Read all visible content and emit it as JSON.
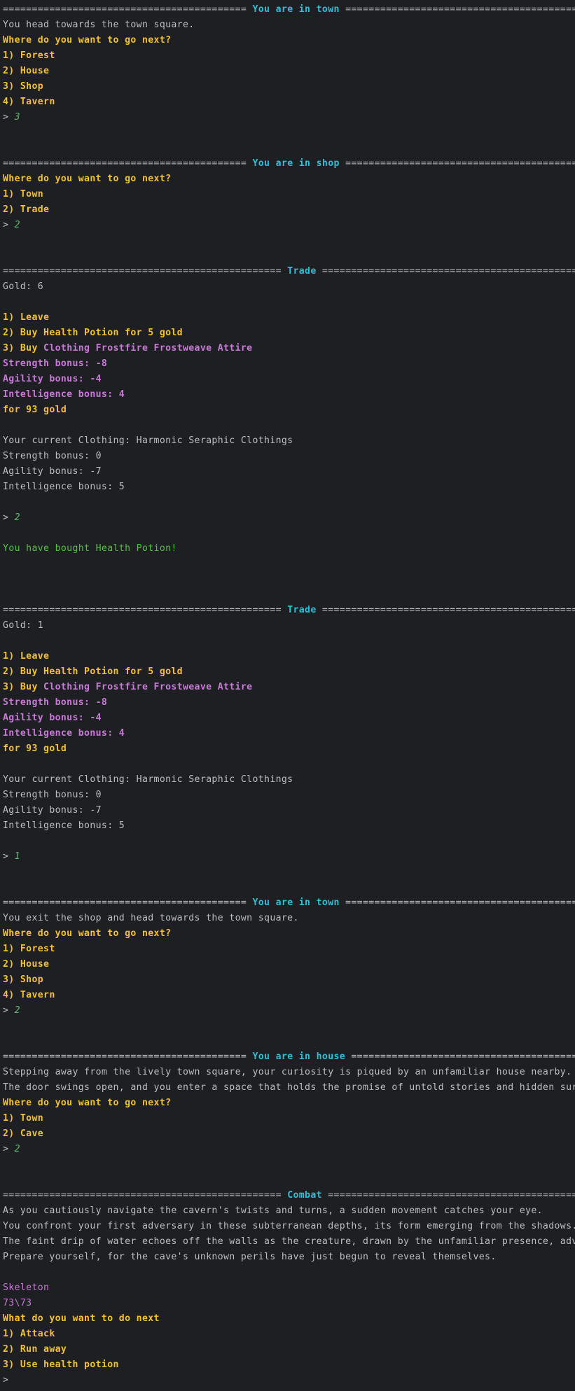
{
  "colors": {
    "background": "#1e1f22",
    "default_text": "#bcbec4",
    "header": "#2fbfd6",
    "menu": "#f2c230",
    "item": "#c77ad6",
    "success": "#4fc43b",
    "input": "#5fb870"
  },
  "lines": [
    [
      {
        "t": "========================================== ",
        "c": "default"
      },
      {
        "t": "You are in town",
        "c": "cyan"
      },
      {
        "t": " ==========================================",
        "c": "default"
      }
    ],
    [
      {
        "t": "You head towards the town square.",
        "c": "default"
      }
    ],
    [
      {
        "t": "Where do you want to go next?",
        "c": "yellow"
      }
    ],
    [
      {
        "t": "1) Forest",
        "c": "yellow"
      }
    ],
    [
      {
        "t": "2) House",
        "c": "yellow"
      }
    ],
    [
      {
        "t": "3) Shop",
        "c": "yellow"
      }
    ],
    [
      {
        "t": "4) Tavern",
        "c": "yellow"
      }
    ],
    [
      {
        "t": "> ",
        "c": "prompt"
      },
      {
        "t": "3",
        "c": "green-italic"
      }
    ],
    [],
    [],
    [
      {
        "t": "========================================== ",
        "c": "default"
      },
      {
        "t": "You are in shop",
        "c": "cyan"
      },
      {
        "t": " ==========================================",
        "c": "default"
      }
    ],
    [
      {
        "t": "Where do you want to go next?",
        "c": "yellow"
      }
    ],
    [
      {
        "t": "1) Town",
        "c": "yellow"
      }
    ],
    [
      {
        "t": "2) Trade",
        "c": "yellow"
      }
    ],
    [
      {
        "t": "> ",
        "c": "prompt"
      },
      {
        "t": "2",
        "c": "green-italic"
      }
    ],
    [],
    [],
    [
      {
        "t": "================================================ ",
        "c": "default"
      },
      {
        "t": "Trade",
        "c": "cyan"
      },
      {
        "t": " ================================================",
        "c": "default"
      }
    ],
    [
      {
        "t": "Gold: 6",
        "c": "default"
      }
    ],
    [],
    [
      {
        "t": "1) Leave",
        "c": "yellow"
      }
    ],
    [
      {
        "t": "2) Buy Health Potion for 5 gold",
        "c": "yellow"
      }
    ],
    [
      {
        "t": "3) Buy ",
        "c": "yellow"
      },
      {
        "t": "Clothing Frostfire Frostweave Attire",
        "c": "purple-bold"
      }
    ],
    [
      {
        "t": "Strength bonus: -8",
        "c": "purple-bold"
      }
    ],
    [
      {
        "t": "Agility bonus: -4",
        "c": "purple-bold"
      }
    ],
    [
      {
        "t": "Intelligence bonus: 4",
        "c": "purple-bold"
      }
    ],
    [
      {
        "t": "for 93 gold",
        "c": "yellow"
      }
    ],
    [],
    [
      {
        "t": "Your current Clothing: Harmonic Seraphic Clothings",
        "c": "default"
      }
    ],
    [
      {
        "t": "Strength bonus: 0",
        "c": "default"
      }
    ],
    [
      {
        "t": "Agility bonus: -7",
        "c": "default"
      }
    ],
    [
      {
        "t": "Intelligence bonus: 5",
        "c": "default"
      }
    ],
    [],
    [
      {
        "t": "> ",
        "c": "prompt"
      },
      {
        "t": "2",
        "c": "green-italic"
      }
    ],
    [],
    [
      {
        "t": "You have bought Health Potion!",
        "c": "green"
      }
    ],
    [],
    [],
    [],
    [
      {
        "t": "================================================ ",
        "c": "default"
      },
      {
        "t": "Trade",
        "c": "cyan"
      },
      {
        "t": " ================================================",
        "c": "default"
      }
    ],
    [
      {
        "t": "Gold: 1",
        "c": "default"
      }
    ],
    [],
    [
      {
        "t": "1) Leave",
        "c": "yellow"
      }
    ],
    [
      {
        "t": "2) Buy Health Potion for 5 gold",
        "c": "yellow"
      }
    ],
    [
      {
        "t": "3) Buy ",
        "c": "yellow"
      },
      {
        "t": "Clothing Frostfire Frostweave Attire",
        "c": "purple-bold"
      }
    ],
    [
      {
        "t": "Strength bonus: -8",
        "c": "purple-bold"
      }
    ],
    [
      {
        "t": "Agility bonus: -4",
        "c": "purple-bold"
      }
    ],
    [
      {
        "t": "Intelligence bonus: 4",
        "c": "purple-bold"
      }
    ],
    [
      {
        "t": "for 93 gold",
        "c": "yellow"
      }
    ],
    [],
    [
      {
        "t": "Your current Clothing: Harmonic Seraphic Clothings",
        "c": "default"
      }
    ],
    [
      {
        "t": "Strength bonus: 0",
        "c": "default"
      }
    ],
    [
      {
        "t": "Agility bonus: -7",
        "c": "default"
      }
    ],
    [
      {
        "t": "Intelligence bonus: 5",
        "c": "default"
      }
    ],
    [],
    [
      {
        "t": "> ",
        "c": "prompt"
      },
      {
        "t": "1",
        "c": "green-italic"
      }
    ],
    [],
    [],
    [
      {
        "t": "========================================== ",
        "c": "default"
      },
      {
        "t": "You are in town",
        "c": "cyan"
      },
      {
        "t": " ==========================================",
        "c": "default"
      }
    ],
    [
      {
        "t": "You exit the shop and head towards the town square.",
        "c": "default"
      }
    ],
    [
      {
        "t": "Where do you want to go next?",
        "c": "yellow"
      }
    ],
    [
      {
        "t": "1) Forest",
        "c": "yellow"
      }
    ],
    [
      {
        "t": "2) House",
        "c": "yellow"
      }
    ],
    [
      {
        "t": "3) Shop",
        "c": "yellow"
      }
    ],
    [
      {
        "t": "4) Tavern",
        "c": "yellow"
      }
    ],
    [
      {
        "t": "> ",
        "c": "prompt"
      },
      {
        "t": "2",
        "c": "green-italic"
      }
    ],
    [],
    [],
    [
      {
        "t": "========================================== ",
        "c": "default"
      },
      {
        "t": "You are in house",
        "c": "cyan"
      },
      {
        "t": " ==========================================",
        "c": "default"
      }
    ],
    [
      {
        "t": "Stepping away from the lively town square, your curiosity is piqued by an unfamiliar house nearby.",
        "c": "default"
      }
    ],
    [
      {
        "t": "The door swings open, and you enter a space that holds the promise of untold stories and hidden surpri",
        "c": "default"
      }
    ],
    [
      {
        "t": "Where do you want to go next?",
        "c": "yellow"
      }
    ],
    [
      {
        "t": "1) Town",
        "c": "yellow"
      }
    ],
    [
      {
        "t": "2) Cave",
        "c": "yellow"
      }
    ],
    [
      {
        "t": "> ",
        "c": "prompt"
      },
      {
        "t": "2",
        "c": "green-italic"
      }
    ],
    [],
    [],
    [
      {
        "t": "================================================ ",
        "c": "default"
      },
      {
        "t": "Combat",
        "c": "cyan"
      },
      {
        "t": " ================================================",
        "c": "default"
      }
    ],
    [
      {
        "t": "As you cautiously navigate the cavern's twists and turns, a sudden movement catches your eye.",
        "c": "default"
      }
    ],
    [
      {
        "t": "You confront your first adversary in these subterranean depths, its form emerging from the shadows.",
        "c": "default"
      }
    ],
    [
      {
        "t": "The faint drip of water echoes off the walls as the creature, drawn by the unfamiliar presence, advanc",
        "c": "default"
      }
    ],
    [
      {
        "t": "Prepare yourself, for the cave's unknown perils have just begun to reveal themselves.",
        "c": "default"
      }
    ],
    [],
    [
      {
        "t": "Skeleton",
        "c": "purple"
      }
    ],
    [
      {
        "t": "73\\73",
        "c": "purple"
      }
    ],
    [
      {
        "t": "What do you want to do next",
        "c": "yellow"
      }
    ],
    [
      {
        "t": "1) Attack",
        "c": "yellow"
      }
    ],
    [
      {
        "t": "2) Run away",
        "c": "yellow"
      }
    ],
    [
      {
        "t": "3) Use health potion",
        "c": "yellow"
      }
    ],
    [
      {
        "t": ">",
        "c": "prompt"
      }
    ]
  ]
}
